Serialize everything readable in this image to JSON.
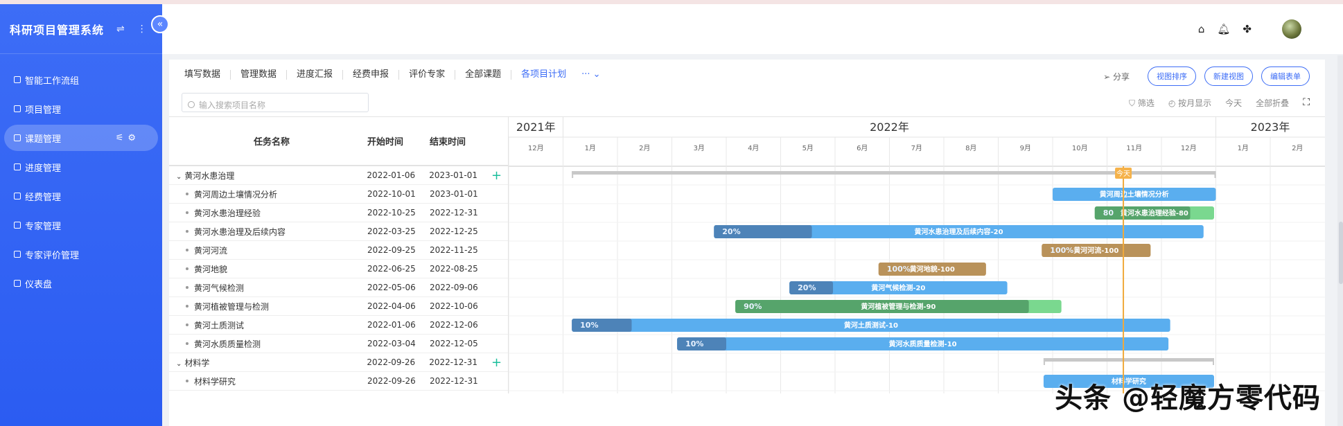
{
  "sidebar": {
    "app_title": "科研项目管理系统",
    "items": [
      {
        "label": "智能工作流组"
      },
      {
        "label": "项目管理"
      },
      {
        "label": "课题管理",
        "active": true
      },
      {
        "label": "进度管理"
      },
      {
        "label": "经费管理"
      },
      {
        "label": "专家管理"
      },
      {
        "label": "专家评价管理"
      },
      {
        "label": "仪表盘"
      }
    ]
  },
  "toolbar": {
    "tabs": [
      "填写数据",
      "管理数据",
      "进度汇报",
      "经费申报",
      "评价专家",
      "全部课题",
      "各项目计划"
    ],
    "more": "···",
    "share": "分享",
    "buttons": [
      "视图排序",
      "新建视图",
      "编辑表单"
    ],
    "search_placeholder": "输入搜索项目名称",
    "filters": [
      "筛选",
      "按月显示",
      "今天",
      "全部折叠"
    ]
  },
  "table": {
    "headers": {
      "name": "任务名称",
      "start": "开始时间",
      "end": "结束时间"
    },
    "rows": [
      {
        "name": "黄河水患治理",
        "start": "2022-01-06",
        "end": "2023-01-01",
        "group": true
      },
      {
        "name": "黄河周边土壤情况分析",
        "start": "2022-10-01",
        "end": "2023-01-01"
      },
      {
        "name": "黄河水患治理经验",
        "start": "2022-10-25",
        "end": "2022-12-31"
      },
      {
        "name": "黄河水患治理及后续内容",
        "start": "2022-03-25",
        "end": "2022-12-25"
      },
      {
        "name": "黄河河流",
        "start": "2022-09-25",
        "end": "2022-11-25"
      },
      {
        "name": "黄河地貌",
        "start": "2022-06-25",
        "end": "2022-08-25"
      },
      {
        "name": "黄河气候检测",
        "start": "2022-05-06",
        "end": "2022-09-06"
      },
      {
        "name": "黄河植被管理与检测",
        "start": "2022-04-06",
        "end": "2022-10-06"
      },
      {
        "name": "黄河土质测试",
        "start": "2022-01-06",
        "end": "2022-12-06"
      },
      {
        "name": "黄河水质质量检测",
        "start": "2022-03-04",
        "end": "2022-12-05"
      },
      {
        "name": "材料学",
        "start": "2022-09-26",
        "end": "2022-12-31",
        "group": true
      },
      {
        "name": "材料学研究",
        "start": "2022-09-26",
        "end": "2022-12-31"
      }
    ]
  },
  "timeline": {
    "years": [
      "2021年",
      "2022年",
      "2023年"
    ],
    "months": [
      "12月",
      "1月",
      "2月",
      "3月",
      "4月",
      "5月",
      "6月",
      "7月",
      "8月",
      "9月",
      "10月",
      "11月",
      "12月",
      "1月",
      "2月"
    ],
    "today_label": "今天",
    "today_date": "2022-11-10",
    "bars": [
      {
        "label": "",
        "start": "2022-01-06",
        "end": "2023-01-01",
        "type": "summary"
      },
      {
        "label": "黄河周边土壤情况分析",
        "start": "2022-10-01",
        "end": "2023-01-01",
        "progress": 0,
        "color": "#5aaeef"
      },
      {
        "label": "黄河水患治理经验-80",
        "progress_text": "80",
        "start": "2022-10-25",
        "end": "2022-12-31",
        "progress": 80,
        "color": "#7ad88f",
        "fill": "#56a46b"
      },
      {
        "label": "黄河水患治理及后续内容-20",
        "progress_text": "20%",
        "start": "2022-03-25",
        "end": "2022-12-25",
        "progress": 20,
        "color": "#5aaeef",
        "fill": "#4d83b8"
      },
      {
        "label": "黄河河流-100",
        "progress_text": "100%",
        "start": "2022-09-25",
        "end": "2022-11-25",
        "progress": 100,
        "color": "#c9a36b",
        "fill": "#b9925a"
      },
      {
        "label": "黄河地貌-100",
        "progress_text": "100%",
        "start": "2022-06-25",
        "end": "2022-08-25",
        "progress": 100,
        "color": "#c9a36b",
        "fill": "#b9925a"
      },
      {
        "label": "黄河气候检测-20",
        "progress_text": "20%",
        "start": "2022-05-06",
        "end": "2022-09-06",
        "progress": 20,
        "color": "#5aaeef",
        "fill": "#4d83b8"
      },
      {
        "label": "黄河植被管理与检测-90",
        "progress_text": "90%",
        "start": "2022-04-06",
        "end": "2022-10-06",
        "progress": 90,
        "color": "#7ad88f",
        "fill": "#56a46b"
      },
      {
        "label": "黄河土质测试-10",
        "progress_text": "10%",
        "start": "2022-01-06",
        "end": "2022-12-06",
        "progress": 10,
        "color": "#5aaeef",
        "fill": "#4d83b8"
      },
      {
        "label": "黄河水质质量检测-10",
        "progress_text": "10%",
        "start": "2022-03-04",
        "end": "2022-12-05",
        "progress": 10,
        "color": "#5aaeef",
        "fill": "#4d83b8"
      },
      {
        "label": "",
        "start": "2022-09-26",
        "end": "2022-12-31",
        "type": "summary"
      },
      {
        "label": "材料学研究",
        "start": "2022-09-26",
        "end": "2022-12-31",
        "progress": 0,
        "color": "#5aaeef"
      }
    ]
  },
  "watermark": "头条 @轻魔方零代码"
}
